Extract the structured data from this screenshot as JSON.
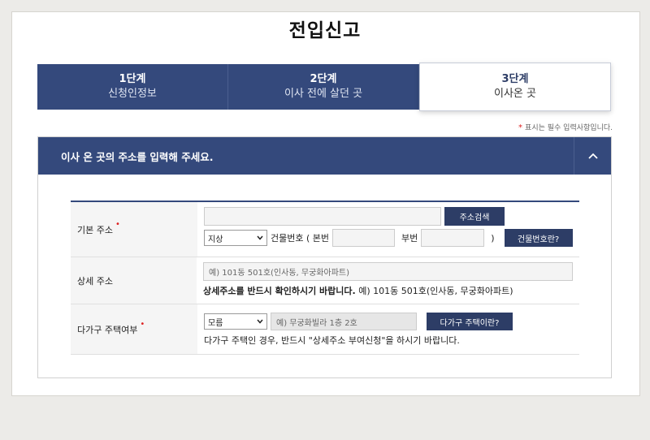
{
  "page": {
    "title": "전입신고"
  },
  "steps": [
    {
      "num": "1단계",
      "label": "신청인정보"
    },
    {
      "num": "2단계",
      "label": "이사 전에 살던 곳"
    },
    {
      "num": "3단계",
      "label": "이사온 곳"
    }
  ],
  "required_note": "표시는 필수 입력사항입니다.",
  "panel": {
    "title": "이사 온 곳의 주소를 입력해 주세요.",
    "rows": {
      "basic": {
        "label": "기본 주소",
        "address_value": "",
        "search_button": "주소검색",
        "land_type": "지상",
        "building_no_label": "건물번호 ( 본번",
        "sub_no_label": "부번",
        "close_paren": ")",
        "building_help_button": "건물번호란?"
      },
      "detail": {
        "label": "상세 주소",
        "placeholder": "예) 101동 501호(인사동, 무궁화아파트)",
        "notice_bold": "상세주소를 반드시 확인하시기 바랍니다.",
        "notice_example": " 예) 101동 501호(인사동, 무궁화아파트)"
      },
      "multi": {
        "label": "다가구 주택여부",
        "select_value": "모름",
        "placeholder": "예) 무궁화빌라 1층 2호",
        "help_button": "다가구 주택이란?",
        "notice": "다가구 주택인 경우, 반드시 \"상세주소 부여신청\"을 하시기 바랍니다."
      }
    }
  },
  "colors": {
    "navy": "#34497c",
    "required_star": "#dd2222"
  }
}
